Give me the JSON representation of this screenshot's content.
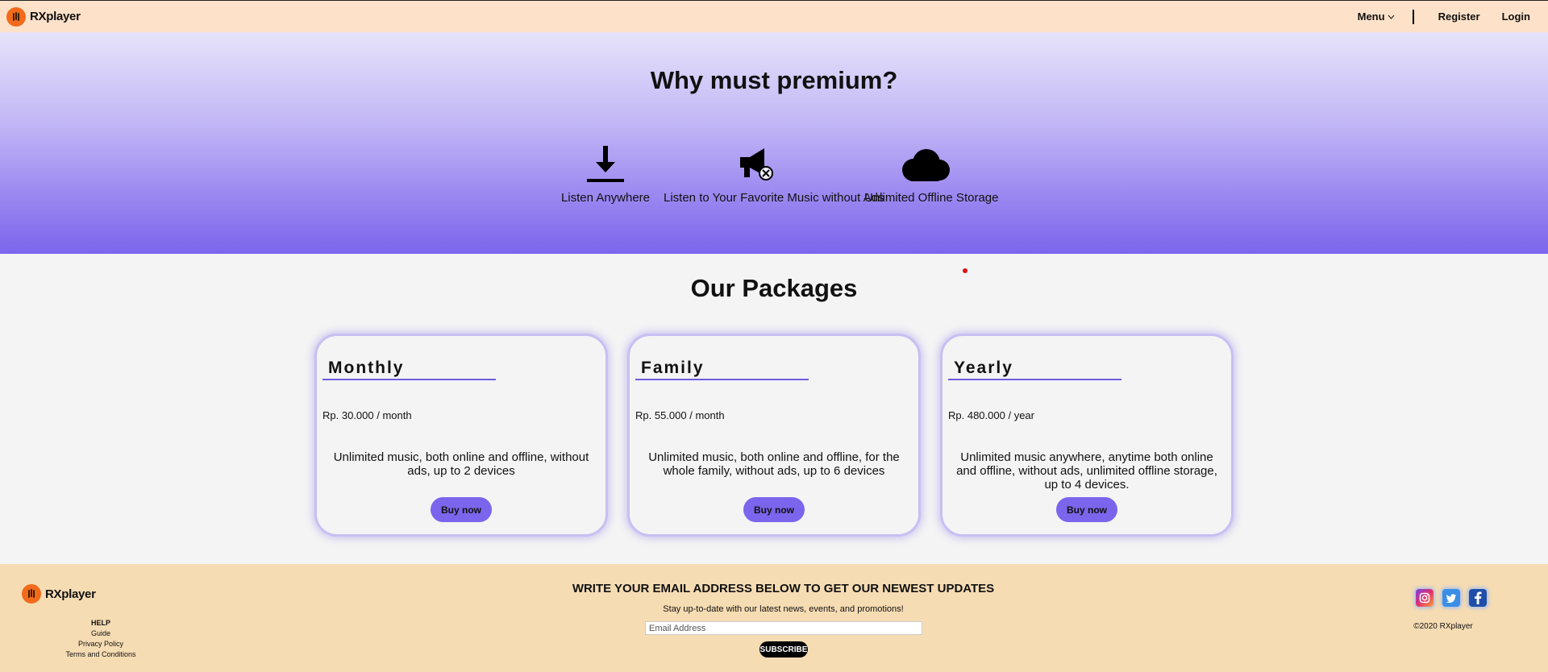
{
  "navbar": {
    "brand": "RXplayer",
    "menu_label": "Menu",
    "register_label": "Register",
    "login_label": "Login",
    "bg_color": "#fde2c9"
  },
  "hero": {
    "title": "Why must premium?",
    "features": [
      {
        "icon": "download-icon",
        "label": "Listen Anywhere"
      },
      {
        "icon": "megaphone-mute-icon",
        "label": "Listen to Your Favorite Music without Ads"
      },
      {
        "icon": "cloud-icon",
        "label": "Unlimited Offline Storage"
      }
    ]
  },
  "packages": {
    "title": "Our Packages",
    "accent_color": "#7b65ec",
    "items": [
      {
        "name": "Monthly",
        "price": "Rp. 30.000",
        "period": "/ month",
        "description": "Unlimited music, both online and offline, without ads, up to 2 devices",
        "button_label": "Buy now"
      },
      {
        "name": "Family",
        "price": "Rp. 55.000",
        "period": "/ month",
        "description": "Unlimited music, both online and offline, for the whole family, without ads, up to 6 devices",
        "button_label": "Buy now"
      },
      {
        "name": "Yearly",
        "price": "Rp. 480.000",
        "period": "/ year",
        "description": "Unlimited music anywhere, anytime both online and offline, without ads, unlimited offline storage, up to 4 devices.",
        "button_label": "Buy now"
      }
    ]
  },
  "footer": {
    "brand": "RXplayer",
    "links": {
      "help": "HELP",
      "guide": "Guide",
      "privacy": "Privacy Policy",
      "terms": "Terms and Conditions"
    },
    "newsletter": {
      "title": "WRITE YOUR EMAIL ADDRESS BELOW TO GET OUR NEWEST UPDATES",
      "subtitle": "Stay up-to-date with our latest news, events, and promotions!",
      "placeholder": "Email Address",
      "button_label": "SUBSCRIBE"
    },
    "socials": [
      "instagram-icon",
      "twitter-icon",
      "facebook-icon"
    ],
    "copyright": "©2020 RXplayer",
    "bg_color": "#f6dcb3"
  }
}
